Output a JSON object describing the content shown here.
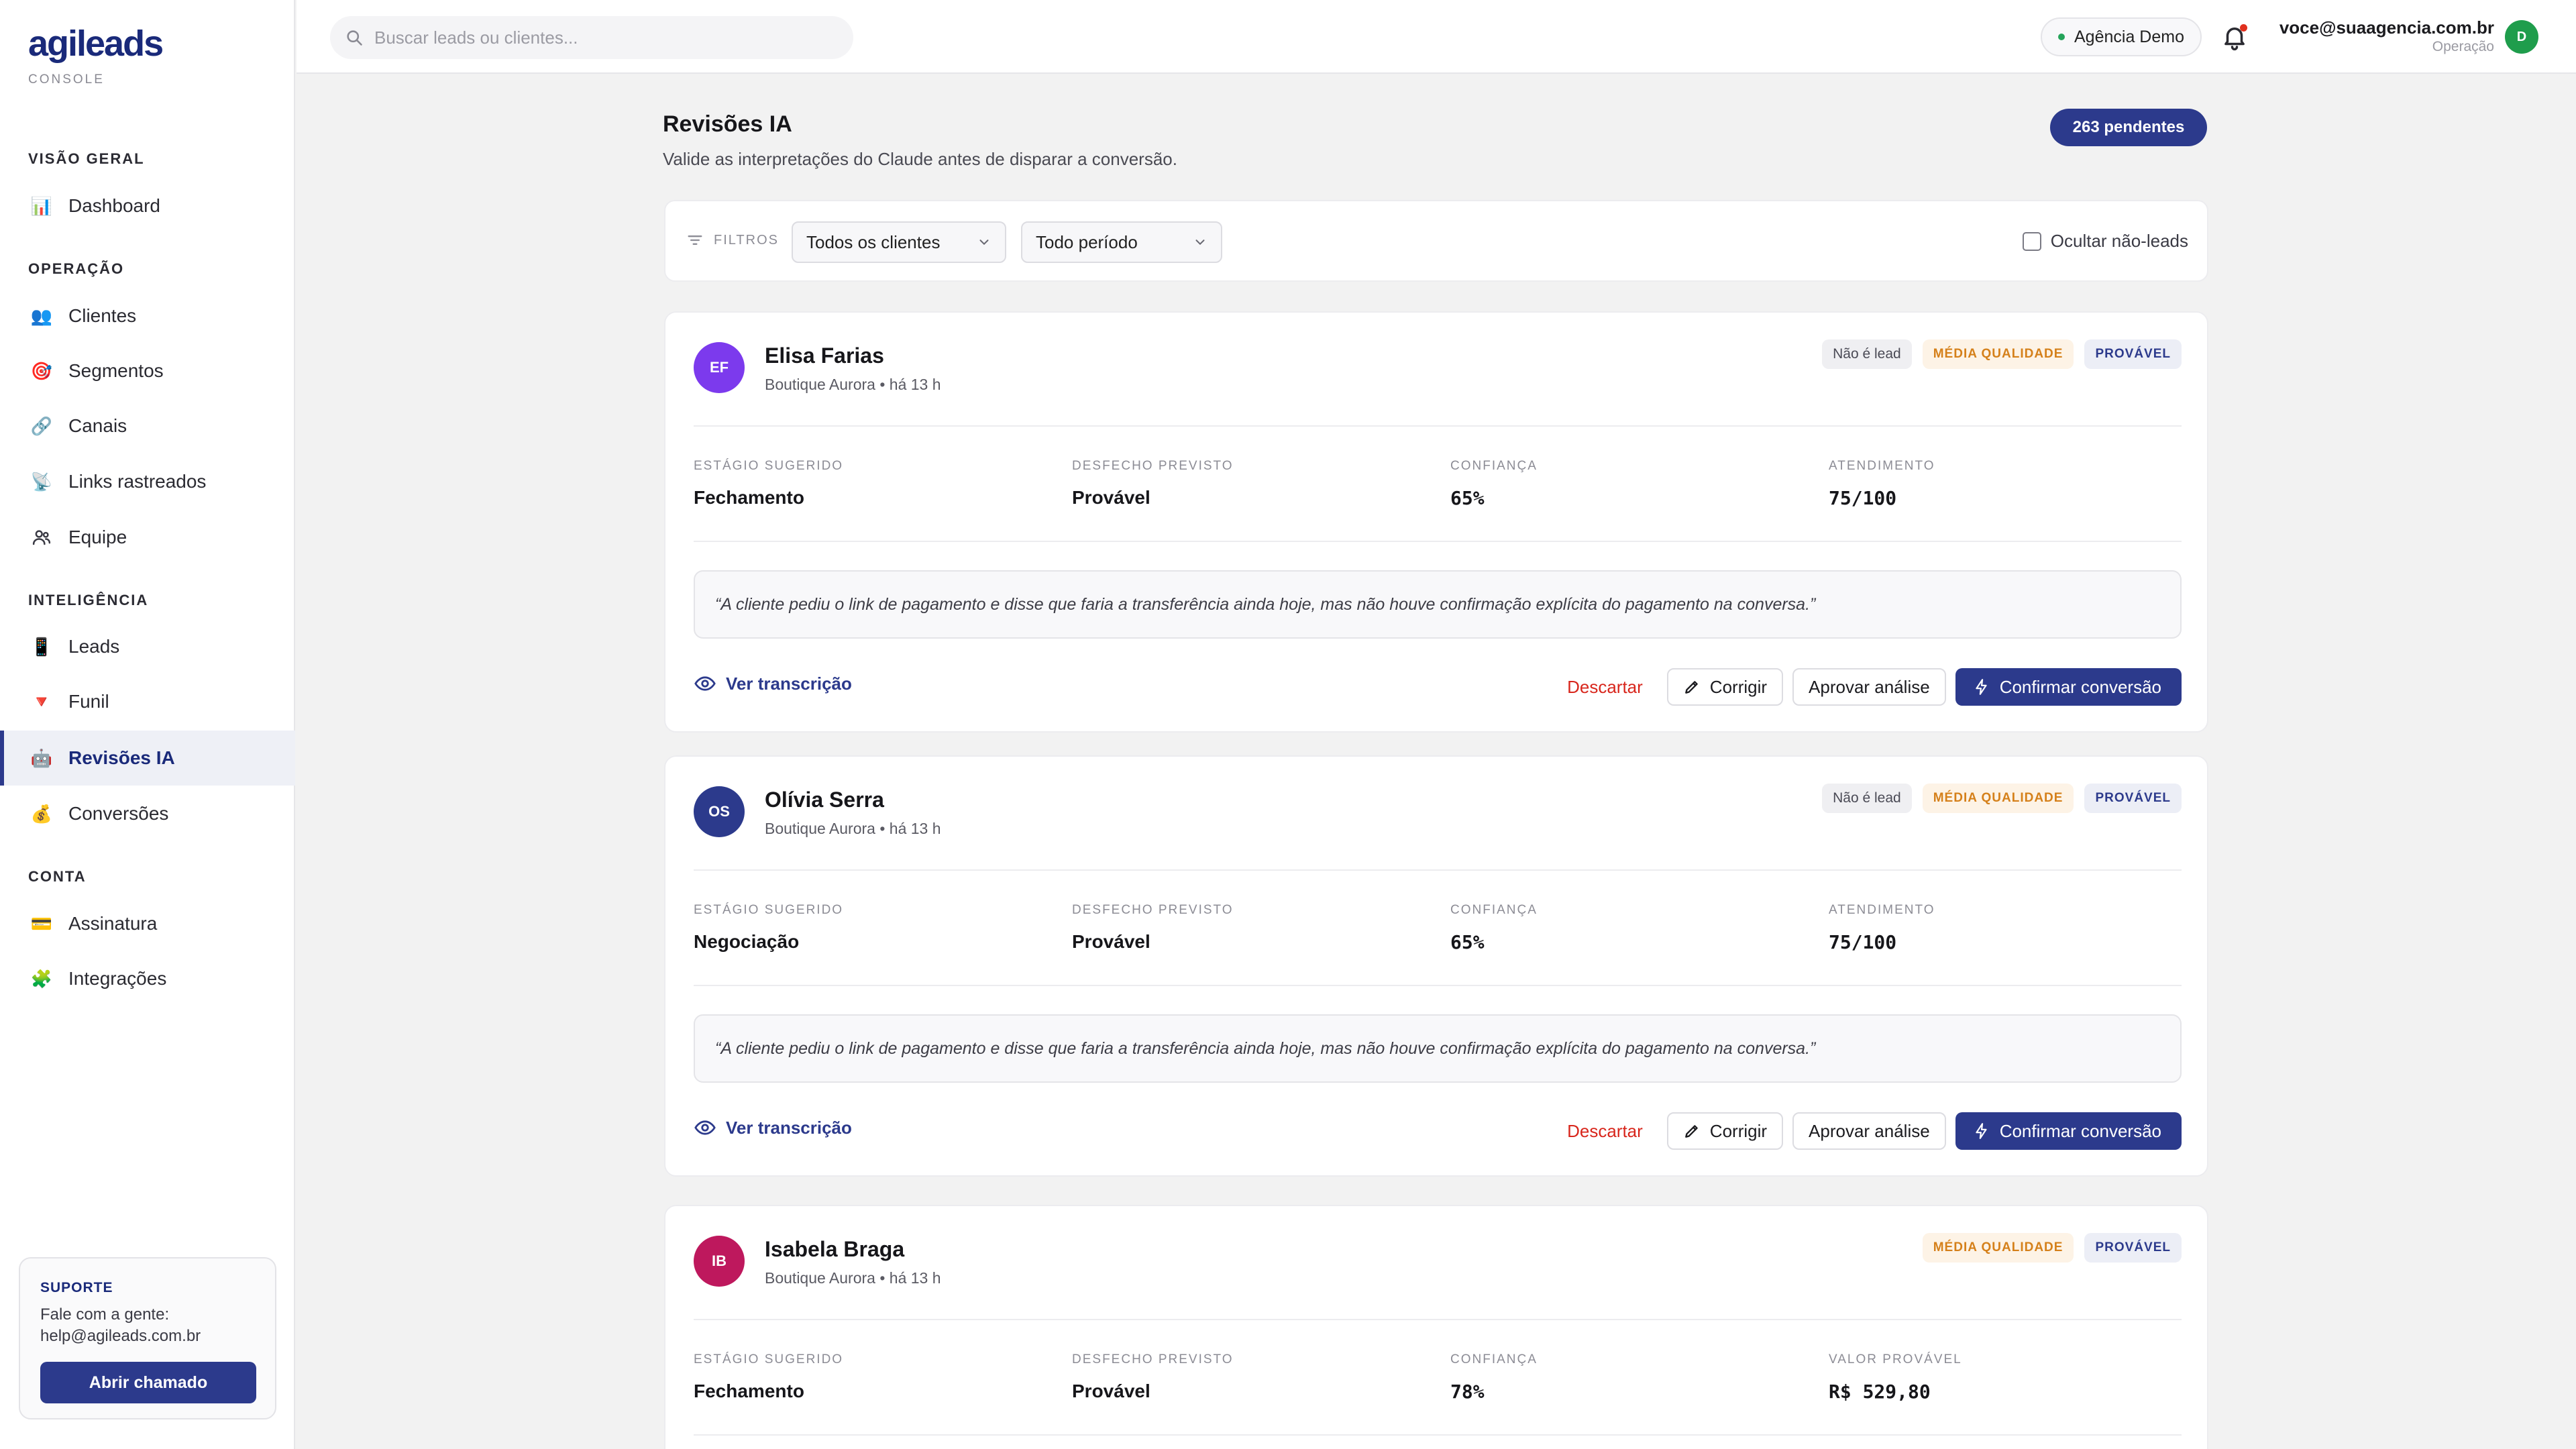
{
  "brand": {
    "logo": "agileads",
    "sub": "CONSOLE"
  },
  "sidebar": {
    "sections": [
      {
        "title": "VISÃO GERAL",
        "items": [
          {
            "label": "Dashboard",
            "icon": "bar-chart-icon",
            "glyph": "📊"
          }
        ]
      },
      {
        "title": "OPERAÇÃO",
        "items": [
          {
            "label": "Clientes",
            "icon": "people-icon",
            "glyph": "👥"
          },
          {
            "label": "Segmentos",
            "icon": "target-icon",
            "glyph": "🎯"
          },
          {
            "label": "Canais",
            "icon": "link-icon",
            "glyph": "🔗"
          },
          {
            "label": "Links rastreados",
            "icon": "satellite-icon",
            "glyph": "📡"
          },
          {
            "label": "Equipe",
            "icon": "team-icon",
            "glyph": ""
          }
        ]
      },
      {
        "title": "INTELIGÊNCIA",
        "items": [
          {
            "label": "Leads",
            "icon": "phone-icon",
            "glyph": "📱"
          },
          {
            "label": "Funil",
            "icon": "funnel-icon",
            "glyph": "🔻"
          },
          {
            "label": "Revisões IA",
            "icon": "robot-icon",
            "glyph": "🤖",
            "active": true
          },
          {
            "label": "Conversões",
            "icon": "money-bag-icon",
            "glyph": "💰"
          }
        ]
      },
      {
        "title": "CONTA",
        "items": [
          {
            "label": "Assinatura",
            "icon": "credit-card-icon",
            "glyph": "💳"
          },
          {
            "label": "Integrações",
            "icon": "puzzle-icon",
            "glyph": "🧩"
          }
        ]
      }
    ],
    "support": {
      "title": "SUPORTE",
      "line1": "Fale com a gente:",
      "line2": "help@agileads.com.br",
      "button": "Abrir chamado"
    }
  },
  "topbar": {
    "search_placeholder": "Buscar leads ou clientes...",
    "agency": "Agência Demo",
    "user_email": "voce@suaagencia.com.br",
    "user_role": "Operação",
    "user_initial": "D"
  },
  "page": {
    "title": "Revisões IA",
    "subtitle": "Valide as interpretações do Claude antes de disparar a conversão.",
    "pending": "263 pendentes"
  },
  "filters": {
    "label": "FILTROS",
    "client": "Todos os clientes",
    "period": "Todo período",
    "hide_label": "Ocultar não-leads"
  },
  "labels": {
    "stage": "ESTÁGIO SUGERIDO",
    "outcome": "DESFECHO PREVISTO",
    "confidence": "CONFIANÇA",
    "transcript": "Ver transcrição",
    "discard": "Descartar",
    "fix": "Corrigir",
    "approve": "Aprovar análise",
    "confirm": "Confirmar conversão"
  },
  "reviews": [
    {
      "initials": "EF",
      "color": "#7c3aed",
      "name": "Elisa Farias",
      "meta": "Boutique Aurora • há 13 h",
      "tags": [
        "Não é lead",
        "MÉDIA QUALIDADE",
        "PROVÁVEL"
      ],
      "stage": "Fechamento",
      "outcome": "Provável",
      "confidence": "65%",
      "fourth_label": "ATENDIMENTO",
      "fourth_value": "75/100",
      "quote": "“A cliente pediu o link de pagamento e disse que faria a transferência ainda hoje, mas não houve confirmação explícita do pagamento na conversa.”"
    },
    {
      "initials": "OS",
      "color": "#2c3a8c",
      "name": "Olívia Serra",
      "meta": "Boutique Aurora • há 13 h",
      "tags": [
        "Não é lead",
        "MÉDIA QUALIDADE",
        "PROVÁVEL"
      ],
      "stage": "Negociação",
      "outcome": "Provável",
      "confidence": "65%",
      "fourth_label": "ATENDIMENTO",
      "fourth_value": "75/100",
      "quote": "“A cliente pediu o link de pagamento e disse que faria a transferência ainda hoje, mas não houve confirmação explícita do pagamento na conversa.”"
    },
    {
      "initials": "IB",
      "color": "#be185d",
      "name": "Isabela Braga",
      "meta": "Boutique Aurora • há 13 h",
      "tags": [
        "MÉDIA QUALIDADE",
        "PROVÁVEL"
      ],
      "stage": "Fechamento",
      "outcome": "Provável",
      "confidence": "78%",
      "fourth_label": "VALOR PROVÁVEL",
      "fourth_value": "R$ 529,80"
    }
  ]
}
